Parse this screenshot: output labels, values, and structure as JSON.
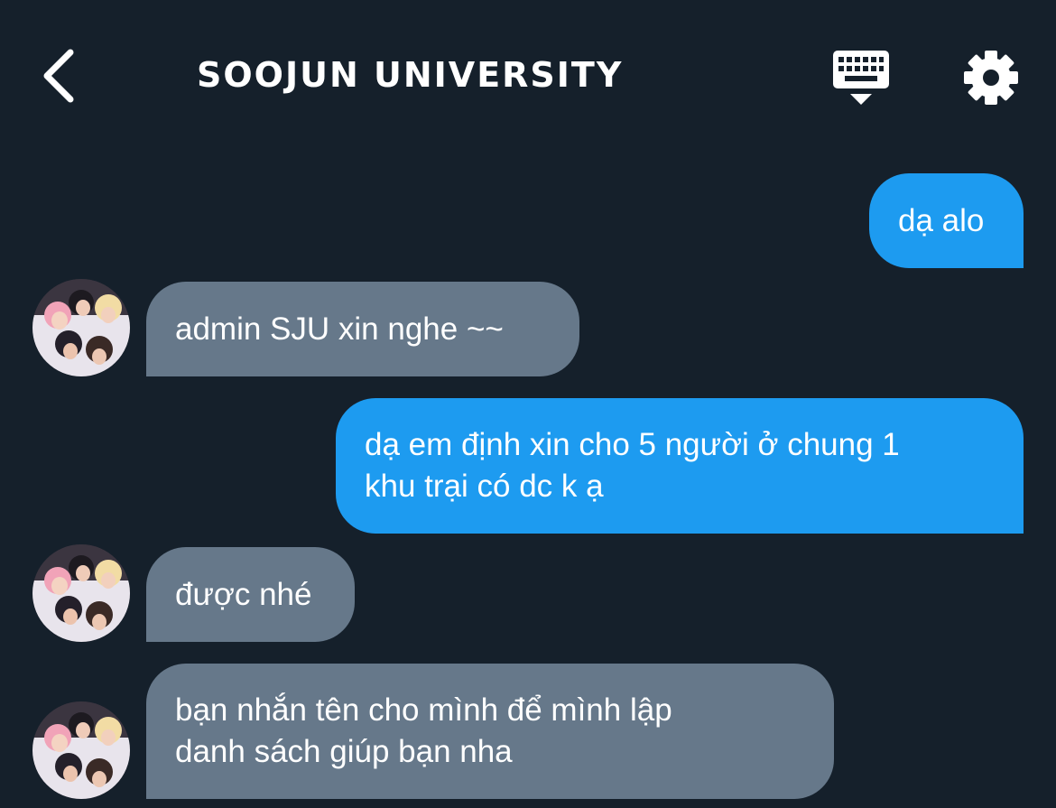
{
  "header": {
    "title": "SOOJUN UNIVERSITY",
    "back_icon": "chevron-left-icon",
    "keyboard_icon": "keyboard-icon",
    "settings_icon": "gear-icon"
  },
  "colors": {
    "background": "#15202b",
    "incoming_bubble": "#66788a",
    "outgoing_bubble": "#1d9bf0",
    "text": "#ffffff"
  },
  "messages": [
    {
      "direction": "outgoing",
      "lines": [
        "dạ alo"
      ]
    },
    {
      "direction": "incoming",
      "lines": [
        "admin SJU xin nghe ~~"
      ]
    },
    {
      "direction": "outgoing",
      "lines": [
        "dạ em định xin cho 5 người ở chung 1",
        "khu trại có dc k ạ"
      ]
    },
    {
      "direction": "incoming",
      "lines": [
        "được nhé"
      ]
    },
    {
      "direction": "incoming",
      "lines": [
        "bạn nhắn tên cho mình để mình lập",
        "danh sách giúp bạn nha"
      ]
    }
  ]
}
